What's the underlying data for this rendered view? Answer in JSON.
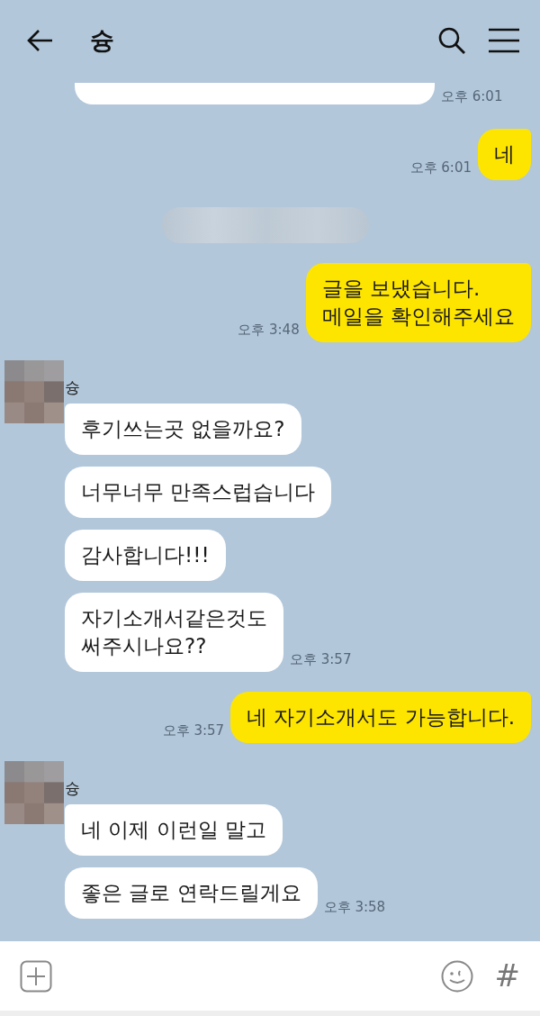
{
  "header": {
    "title": "슝"
  },
  "messages": [
    {
      "kind": "partial",
      "time": "오후 6:01"
    },
    {
      "kind": "out",
      "text": "네",
      "time": "오후 6:01"
    },
    {
      "kind": "divider"
    },
    {
      "kind": "out",
      "text": "글을 보냈습니다.\n메일을 확인해주세요",
      "time": "오후 3:48"
    },
    {
      "kind": "in",
      "sender": "슝",
      "bubbles": [
        {
          "text": "후기쓰는곳 없을까요?"
        },
        {
          "text": "너무너무 만족스럽습니다"
        },
        {
          "text": "감사합니다!!!"
        },
        {
          "text": "자기소개서같은것도\n써주시나요??",
          "time": "오후 3:57"
        }
      ]
    },
    {
      "kind": "out",
      "text": "네 자기소개서도 가능합니다.",
      "time": "오후 3:57"
    },
    {
      "kind": "in",
      "sender": "슝",
      "bubbles": [
        {
          "text": "네 이제 이런일 말고"
        },
        {
          "text": "좋은 글로 연락드릴게요",
          "time": "오후 3:58"
        }
      ]
    }
  ],
  "footer": {
    "hash": "#"
  }
}
